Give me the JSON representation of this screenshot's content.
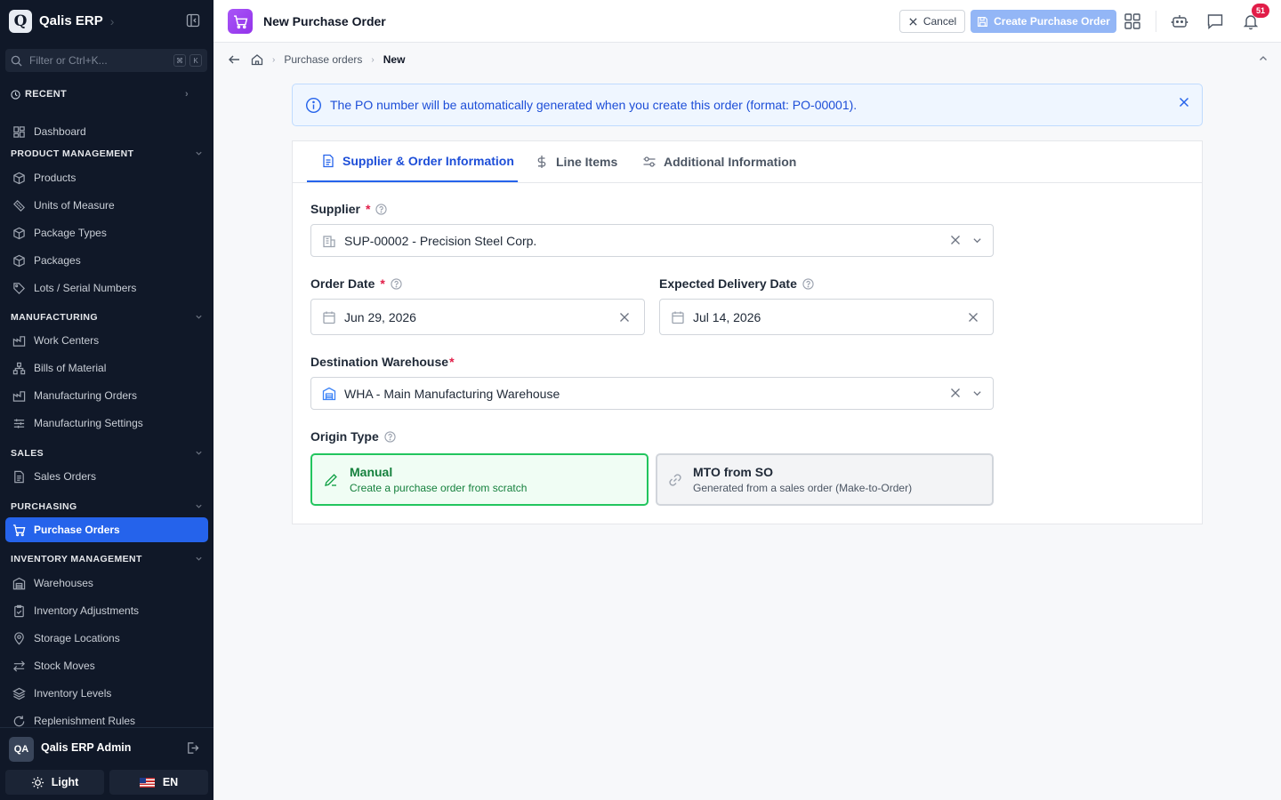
{
  "app": {
    "logo_letter": "Q",
    "name": "Qalis ERP"
  },
  "sidebar": {
    "filter_placeholder": "Filter or Ctrl+K...",
    "kbd": [
      "⌘",
      "K"
    ],
    "recent_label": "RECENT",
    "dashboard": "Dashboard",
    "sections": {
      "product": "PRODUCT MANAGEMENT",
      "manufacturing": "MANUFACTURING",
      "sales": "SALES",
      "purchasing": "PURCHASING",
      "inventory": "INVENTORY MANAGEMENT"
    },
    "items": {
      "products": "Products",
      "uom": "Units of Measure",
      "package_types": "Package Types",
      "packages": "Packages",
      "lots": "Lots / Serial Numbers",
      "work_centers": "Work Centers",
      "bom": "Bills of Material",
      "mo": "Manufacturing Orders",
      "mfg_settings": "Manufacturing Settings",
      "sales_orders": "Sales Orders",
      "purchase_orders": "Purchase Orders",
      "warehouses": "Warehouses",
      "inv_adjust": "Inventory Adjustments",
      "storage": "Storage Locations",
      "stock_moves": "Stock Moves",
      "inv_levels": "Inventory Levels",
      "replenish": "Replenishment Rules"
    },
    "user": {
      "initials": "QA",
      "name": "Qalis ERP Admin"
    },
    "theme_label": "Light",
    "lang_label": "EN"
  },
  "topbar": {
    "title": "New Purchase Order",
    "cancel": "Cancel",
    "create": "Create Purchase Order",
    "notification_count": "51"
  },
  "breadcrumb": {
    "parent": "Purchase orders",
    "current": "New"
  },
  "info_banner": "The PO number will be automatically generated when you create this order (format: PO-00001).",
  "tabs": [
    "Supplier & Order Information",
    "Line Items",
    "Additional Information"
  ],
  "form": {
    "supplier_label": "Supplier",
    "supplier_value": "SUP-00002 - Precision Steel Corp.",
    "order_date_label": "Order Date",
    "order_date_value": "Jun 29, 2026",
    "delivery_label": "Expected Delivery Date",
    "delivery_value": "Jul 14, 2026",
    "warehouse_label": "Destination Warehouse",
    "warehouse_value": "WHA - Main Manufacturing Warehouse",
    "origin_label": "Origin Type",
    "origin_options": [
      {
        "title": "Manual",
        "desc": "Create a purchase order from scratch"
      },
      {
        "title": "MTO from SO",
        "desc": "Generated from a sales order (Make-to-Order)"
      }
    ],
    "required_mark": "*"
  },
  "colors": {
    "accent": "#2563eb",
    "sidebar_bg": "#101828",
    "success": "#22c55e",
    "badge": "#e11d48"
  }
}
